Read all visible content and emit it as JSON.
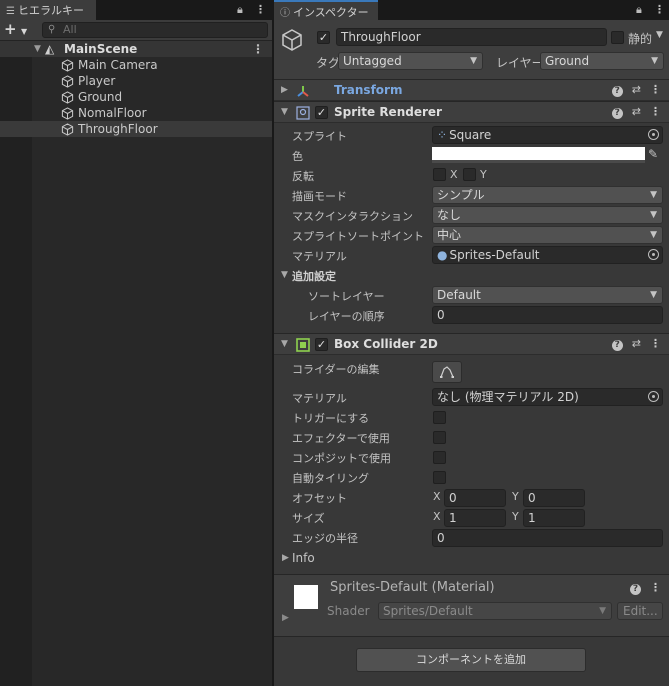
{
  "hierarchy": {
    "tab_label": "ヒエラルキー",
    "search_placeholder": "All",
    "scene_name": "MainScene",
    "objects": [
      "Main Camera",
      "Player",
      "Ground",
      "NomalFloor",
      "ThroughFloor"
    ],
    "selected_index": 4
  },
  "inspector": {
    "tab_label": "インスペクター",
    "object_name": "ThroughFloor",
    "active": true,
    "static_label": "静的",
    "tag_label": "タグ",
    "tag_value": "Untagged",
    "layer_label": "レイヤー",
    "layer_value": "Ground",
    "transform": {
      "title": "Transform"
    },
    "sprite_renderer": {
      "title": "Sprite Renderer",
      "sprite_label": "スプライト",
      "sprite_value": "Square",
      "color_label": "色",
      "flip_label": "反転",
      "flip_x": "X",
      "flip_y": "Y",
      "draw_mode_label": "描画モード",
      "draw_mode_value": "シンプル",
      "mask_label": "マスクインタラクション",
      "mask_value": "なし",
      "sort_point_label": "スプライトソートポイント",
      "sort_point_value": "中心",
      "material_label": "マテリアル",
      "material_value": "Sprites-Default",
      "additional_label": "追加設定",
      "sorting_layer_label": "ソートレイヤー",
      "sorting_layer_value": "Default",
      "order_label": "レイヤーの順序",
      "order_value": "0"
    },
    "box_collider": {
      "title": "Box Collider 2D",
      "edit_label": "コライダーの編集",
      "material_label": "マテリアル",
      "material_value": "なし (物理マテリアル 2D)",
      "trigger_label": "トリガーにする",
      "effector_label": "エフェクターで使用",
      "composite_label": "コンポジットで使用",
      "autotile_label": "自動タイリング",
      "offset_label": "オフセット",
      "offset_x": "0",
      "offset_y": "0",
      "size_label": "サイズ",
      "size_x": "1",
      "size_y": "1",
      "edge_label": "エッジの半径",
      "edge_value": "0",
      "info_label": "Info",
      "axis_x": "X",
      "axis_y": "Y"
    },
    "material_preview": {
      "title": "Sprites-Default (Material)",
      "shader_label": "Shader",
      "shader_value": "Sprites/Default",
      "edit_label": "Edit..."
    },
    "add_component_label": "コンポーネントを追加"
  },
  "colors": {
    "accent": "#3a79bb",
    "transform_title": "#7aa7e0"
  }
}
